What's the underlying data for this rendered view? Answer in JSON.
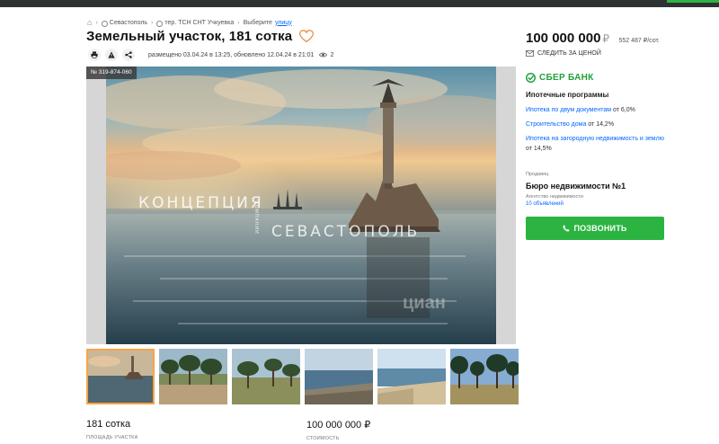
{
  "breadcrumb": {
    "city": "Севастополь",
    "area": "тер. ТСН СНТ Учкуевка",
    "street_prefix": "Выберите",
    "street_link": "улицу"
  },
  "listing": {
    "title": "Земельный участок, 181 сотка",
    "posted": "размещено 03.04.24 в 13:25, обновлено 12.04.24 в 21:01",
    "views": "2",
    "id_badge": "№ 319-874-060"
  },
  "photo_watermark": {
    "word1": "КОНЦЕПЦИЯ",
    "small": "КОМПАНИИ",
    "word2": "СЕВАСТОПОЛЬ",
    "cian": "циан"
  },
  "facts": [
    {
      "value": "181 сотка",
      "label": "ПЛОЩАДЬ УЧАСТКА"
    },
    {
      "value": "100 000 000 ₽",
      "label": "СТОИМОСТЬ"
    }
  ],
  "price": {
    "amount": "100 000 000",
    "currency": "₽",
    "per_unit": "552 487 ₽/сот.",
    "follow_label": "СЛЕДИТЬ ЗА ЦЕНОЙ"
  },
  "bank": {
    "name": "СБЕР БАНК",
    "programs_title": "Ипотечные программы",
    "programs": [
      {
        "link": "Ипотека по двум документам",
        "rate": "от 6,0%"
      },
      {
        "link": "Строительство дома",
        "rate": "от 14,2%"
      },
      {
        "link": "Ипотека на загородную недвижимость и землю",
        "rate": "от 14,5%"
      }
    ]
  },
  "seller": {
    "label": "Продавец",
    "name": "Бюро недвижимости №1",
    "type": "Агентство недвижимости",
    "ads": "10 объявлений"
  },
  "call_button": "ПОЗВОНИТЬ",
  "colors": {
    "accent_green": "#2bb441",
    "sber_green": "#21a038",
    "link_blue": "#0468ff",
    "thumb_active": "#f8a446"
  }
}
